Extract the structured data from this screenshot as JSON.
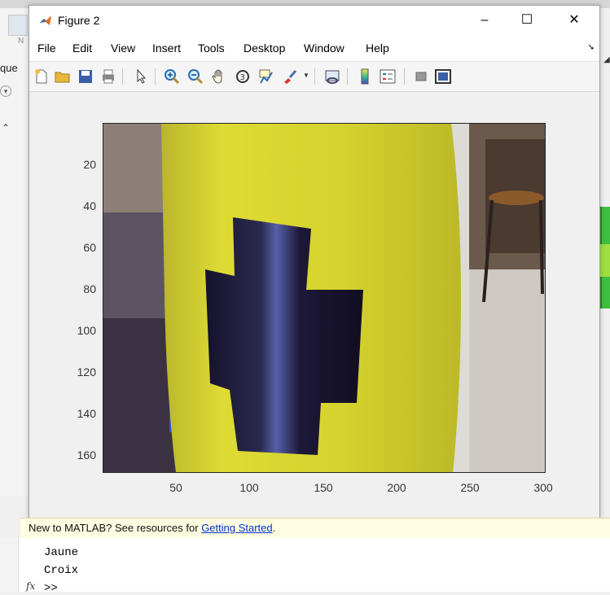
{
  "window": {
    "title": "Figure 2",
    "minimize_glyph": "–",
    "maximize_glyph": "☐",
    "close_glyph": "✕"
  },
  "menu": [
    "File",
    "Edit",
    "View",
    "Insert",
    "Tools",
    "Desktop",
    "Window",
    "Help"
  ],
  "toolbar_icons": [
    "new-figure-icon",
    "open-file-icon",
    "save-icon",
    "print-icon",
    "select-arrow-icon",
    "zoom-in-icon",
    "zoom-out-icon",
    "pan-hand-icon",
    "rotate-3d-icon",
    "data-cursor-icon",
    "brush-icon",
    "brush-dropdown-icon",
    "link-plot-icon",
    "colorbar-icon",
    "legend-icon",
    "hide-tools-icon",
    "dock-icon"
  ],
  "axes": {
    "yticks": [
      "20",
      "40",
      "60",
      "80",
      "100",
      "120",
      "140",
      "160"
    ],
    "xticks": [
      "50",
      "100",
      "150",
      "200",
      "250",
      "300"
    ]
  },
  "background": {
    "left_label": "que",
    "left_small_label": "N"
  },
  "hint": {
    "prefix": "New to MATLAB? See resources for ",
    "link": "Getting Started",
    "suffix": "."
  },
  "console": {
    "lines": [
      "Jaune",
      "Croix"
    ],
    "prompt": ">>",
    "fx": "fx"
  },
  "colors": {
    "yellow": "#d8d42a",
    "cross": "#1a1630",
    "floor": "#c7c2bc"
  }
}
